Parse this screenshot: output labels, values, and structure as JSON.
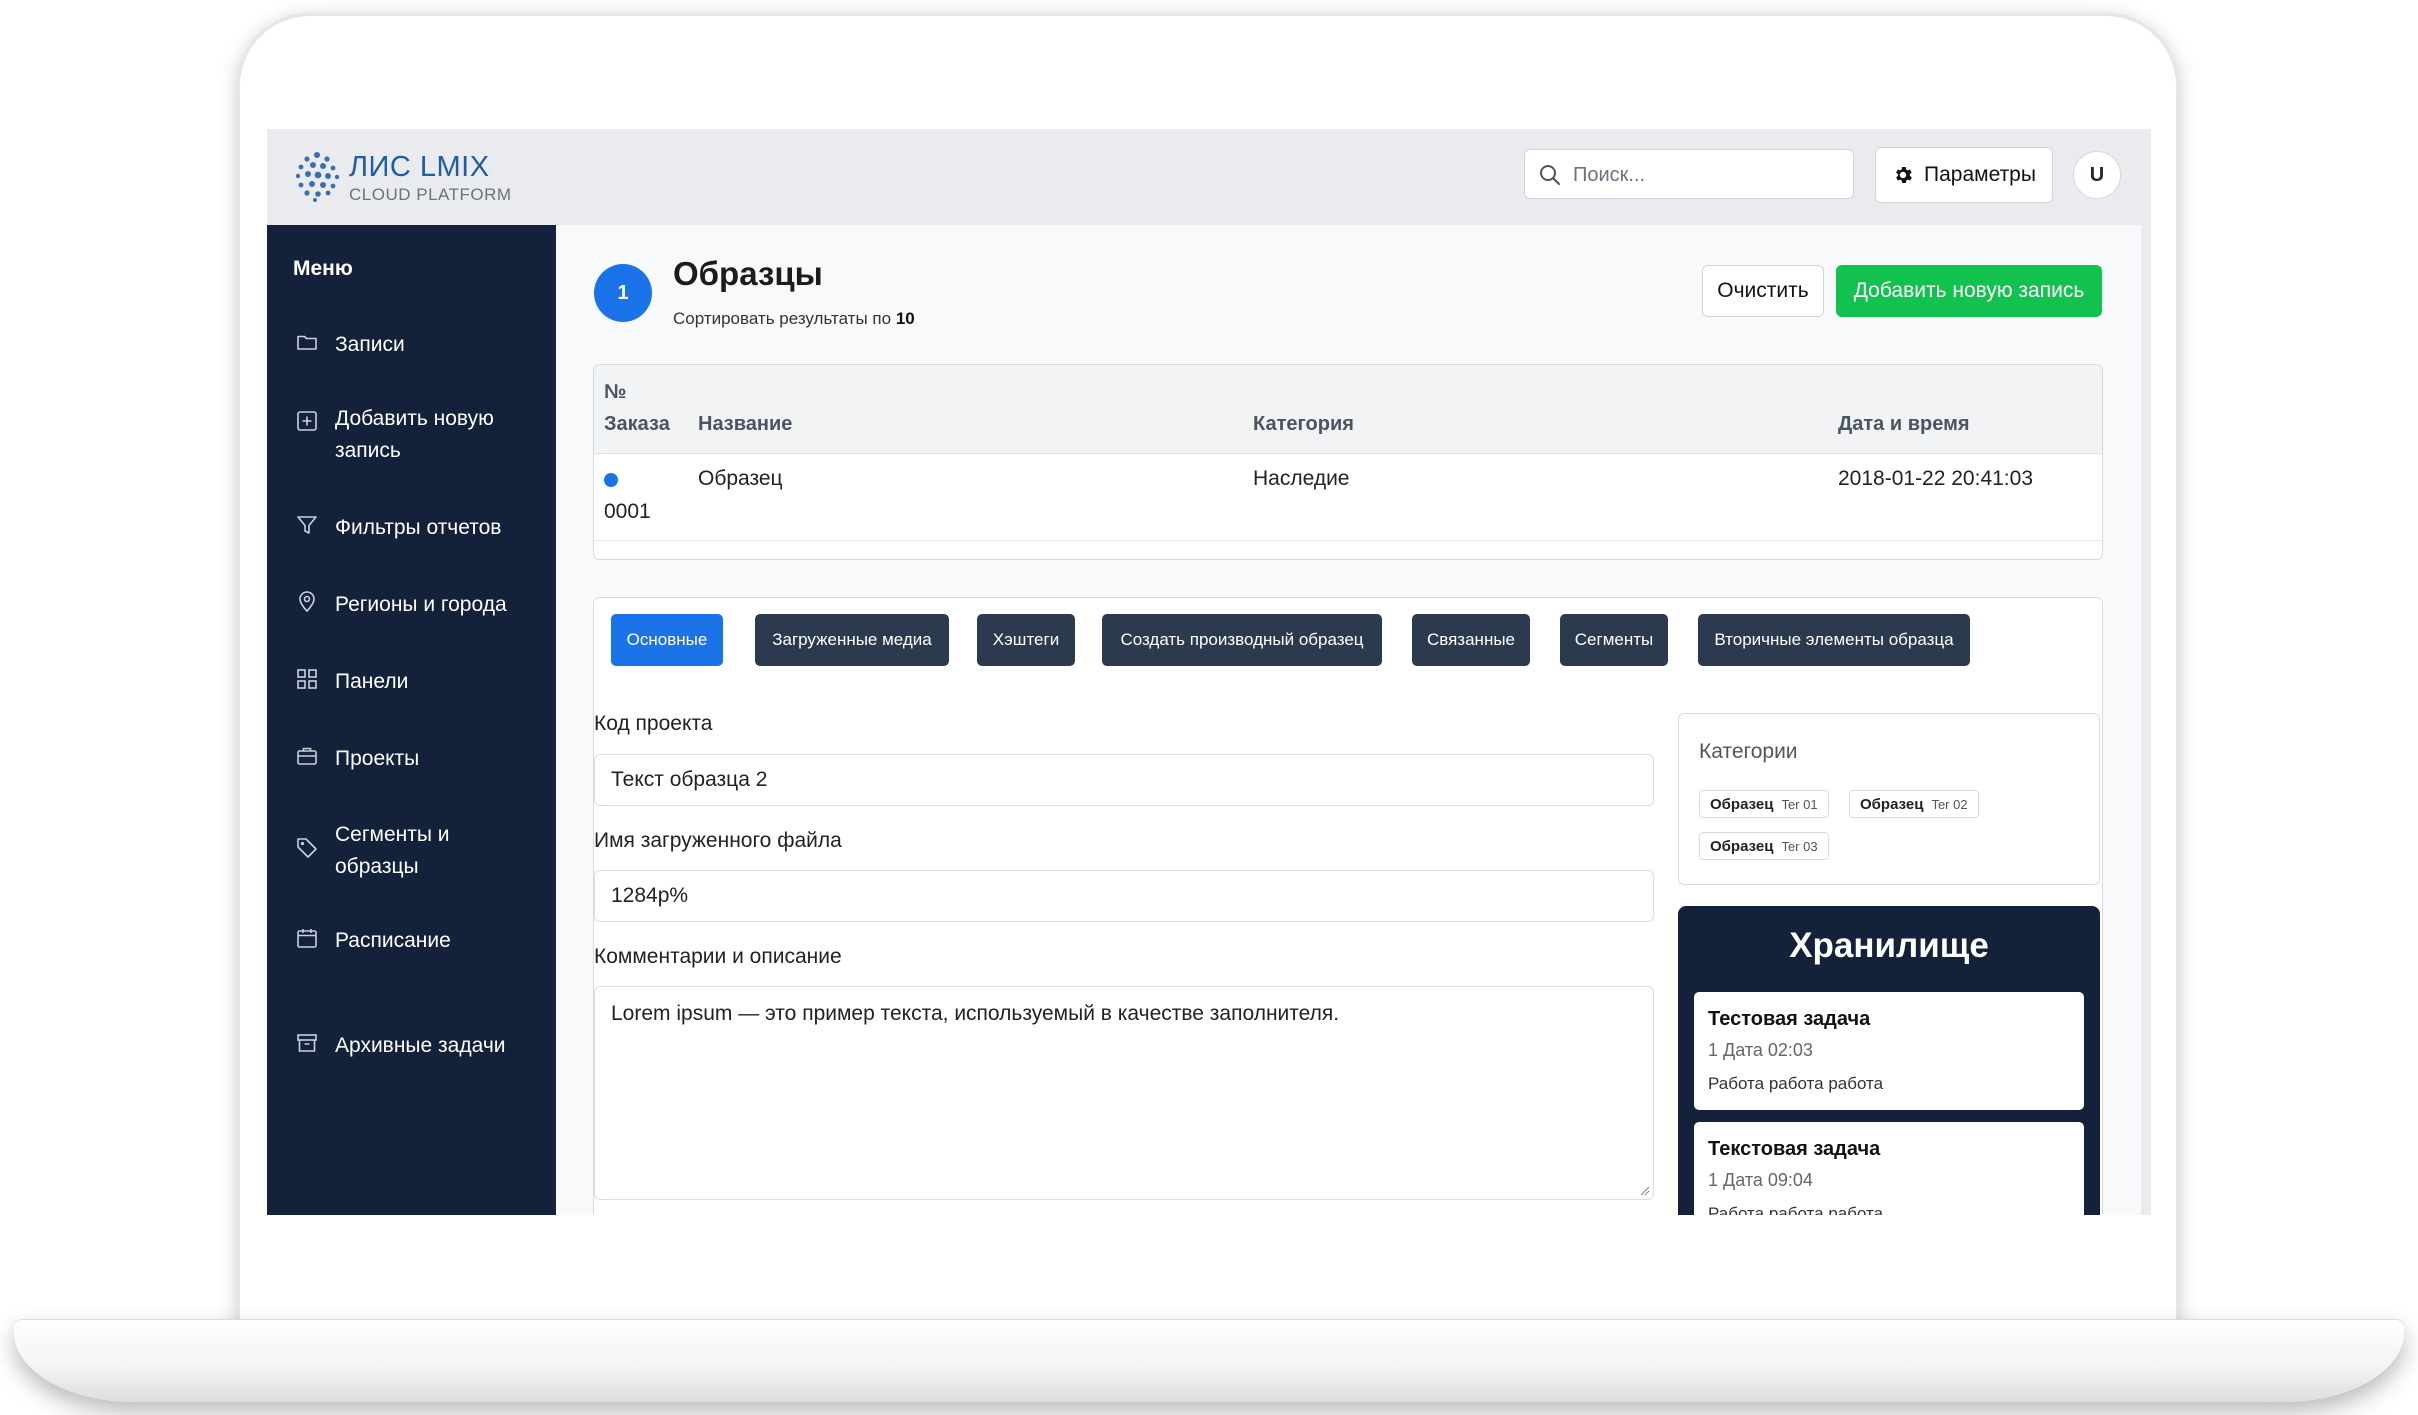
{
  "app": {
    "logo_title": "ЛИС LMIX",
    "logo_subtitle": "CLOUD PLATFORM"
  },
  "topbar": {
    "search_placeholder": "Поиск...",
    "params_label": "Параметры",
    "avatar_initial": "U"
  },
  "sidebar": {
    "title": "Меню",
    "items": [
      {
        "label": "Записи",
        "icon": "folder-icon"
      },
      {
        "label": "Добавить новую запись",
        "icon": "plus-square-icon"
      },
      {
        "label": "Фильтры отчетов",
        "icon": "filter-icon"
      },
      {
        "label": "Регионы и города",
        "icon": "map-pin-icon"
      },
      {
        "label": "Панели",
        "icon": "grid-icon"
      },
      {
        "label": "Проекты",
        "icon": "briefcase-icon"
      },
      {
        "label": "Сегменты и образцы",
        "icon": "tag-icon"
      },
      {
        "label": "Расписание",
        "icon": "calendar-icon"
      },
      {
        "label": "Архивные задачи",
        "icon": "archive-icon"
      }
    ]
  },
  "page": {
    "badge": "1",
    "title": "Образцы",
    "sort_text": "Сортировать результаты по",
    "sort_value": "10",
    "clear_label": "Очистить",
    "add_label": "Добавить новую запись"
  },
  "table": {
    "headers": {
      "order_line1": "№",
      "order_line2": "Заказа",
      "name": "Название",
      "category": "Категория",
      "datetime": "Дата и время"
    },
    "rows": [
      {
        "order": "0001",
        "name": "Образец",
        "category": "Наследие",
        "datetime": "2018-01-22 20:41:03",
        "status_color": "#1a73e8"
      }
    ]
  },
  "tabs": [
    {
      "label": "Основные",
      "active": true
    },
    {
      "label": "Загруженные медиа",
      "active": false
    },
    {
      "label": "Хэштеги",
      "active": false
    },
    {
      "label": "Создать производный образец",
      "active": false
    },
    {
      "label": "Связанные",
      "active": false
    },
    {
      "label": "Сегменты",
      "active": false
    },
    {
      "label": "Вторичные элементы образца",
      "active": false
    }
  ],
  "form": {
    "project_code_label": "Код проекта",
    "project_code_value": "Текст образца 2",
    "file_name_label": "Имя загруженного файла",
    "file_name_value": "1284p%",
    "comments_label": "Комментарии и описание",
    "comments_value": "Lorem ipsum — это пример текста, используемый в качестве заполнителя."
  },
  "categories": {
    "title": "Категории",
    "tags": [
      {
        "name": "Образец",
        "tag": "Ter 01"
      },
      {
        "name": "Образец",
        "tag": "Ter 02"
      },
      {
        "name": "Образец",
        "tag": "Ter 03"
      }
    ]
  },
  "storage": {
    "title": "Хранилище",
    "tasks": [
      {
        "title": "Тестовая задача",
        "date": "1 Дата 02:03",
        "desc": "Работа работа работа"
      },
      {
        "title": "Текстовая задача",
        "date": "1 Дата 09:04",
        "desc": "Работа работа работа"
      }
    ]
  },
  "colors": {
    "sidebar_bg": "#14213a",
    "accent_blue": "#1a73e8",
    "success_green": "#12c24e",
    "tab_dark": "#2b3a4f"
  }
}
